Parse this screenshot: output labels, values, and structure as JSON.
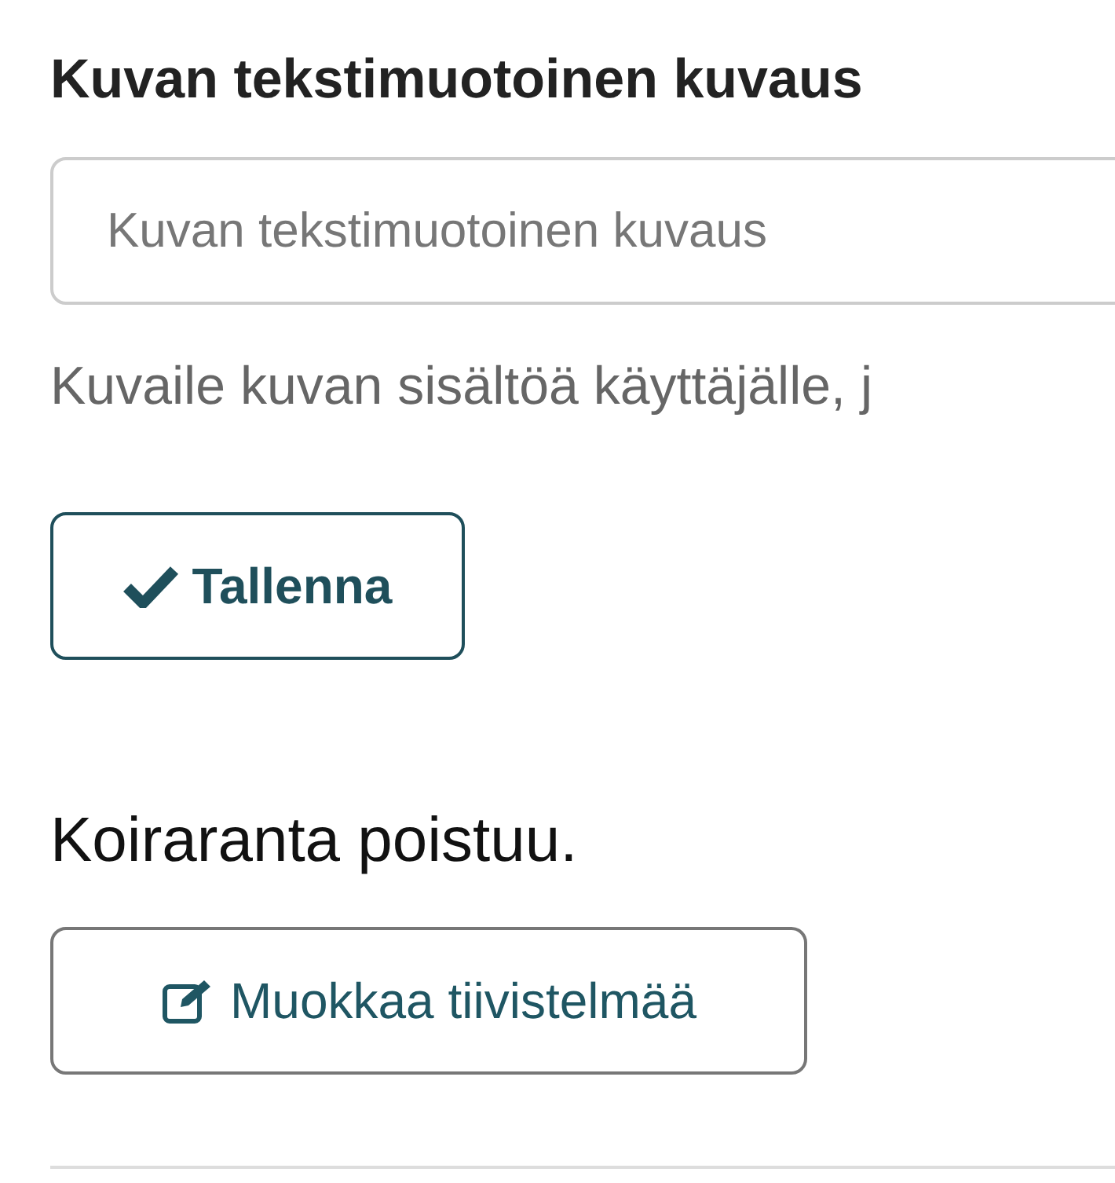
{
  "field": {
    "label": "Kuvan tekstimuotoinen kuvaus",
    "placeholder": "Kuvan tekstimuotoinen kuvaus",
    "help": "Kuvaile kuvan sisältöä käyttäjälle, j"
  },
  "save_button": {
    "label": "Tallenna"
  },
  "summary": {
    "text": "Koiraranta poistuu."
  },
  "edit_button": {
    "label": "Muokkaa tiivistelmää"
  }
}
